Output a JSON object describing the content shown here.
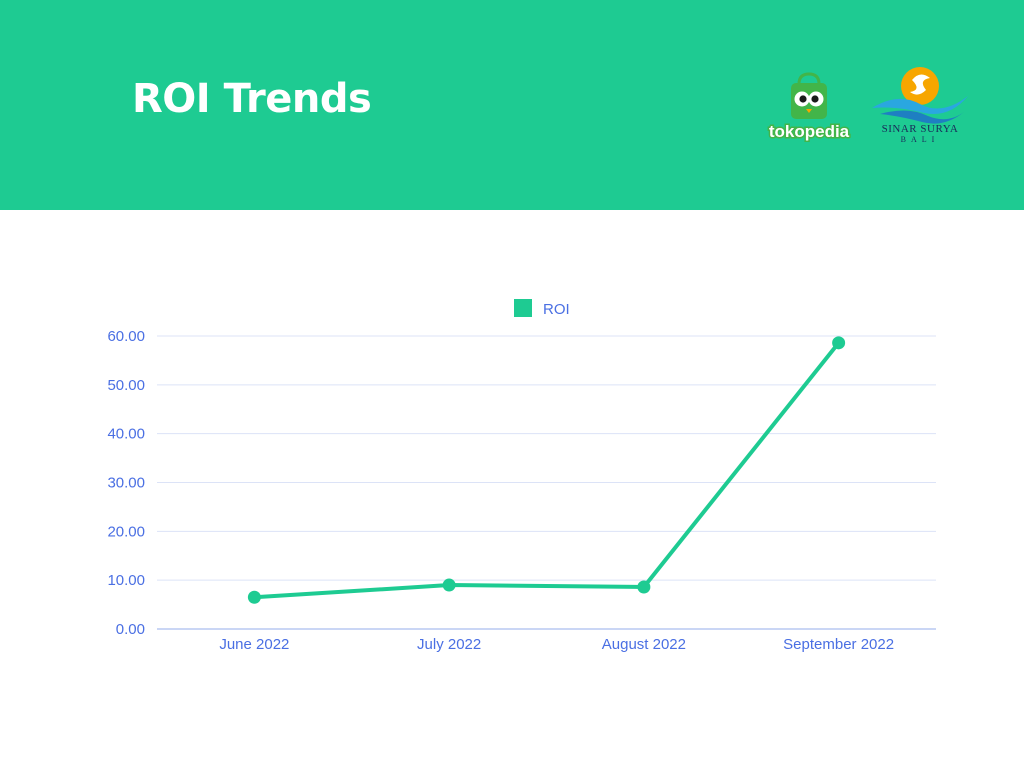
{
  "header": {
    "title": "ROI Trends",
    "background": "#1ECB92"
  },
  "logos": {
    "tokopedia": {
      "text": "tokopedia",
      "icon": "owl-shopping-bag-icon",
      "color": "#42B549"
    },
    "sinar_surya": {
      "line1": "SINAR SURYA",
      "line2": "BALI",
      "icon": "sun-wave-icon",
      "color": "#2AA7E0"
    }
  },
  "chart_data": {
    "type": "line",
    "categories": [
      "June 2022",
      "July 2022",
      "August 2022",
      "September 2022"
    ],
    "series": [
      {
        "name": "ROI",
        "values": [
          6.5,
          9.0,
          8.6,
          58.6
        ],
        "color": "#1ECB92"
      }
    ],
    "yticks": [
      "0.00",
      "10.00",
      "20.00",
      "30.00",
      "40.00",
      "50.00",
      "60.00"
    ],
    "ylim": [
      0,
      60
    ],
    "legend": "top-center",
    "grid": true,
    "axis_text_color": "#4A6FE3",
    "grid_color": "#DCE3F7"
  }
}
